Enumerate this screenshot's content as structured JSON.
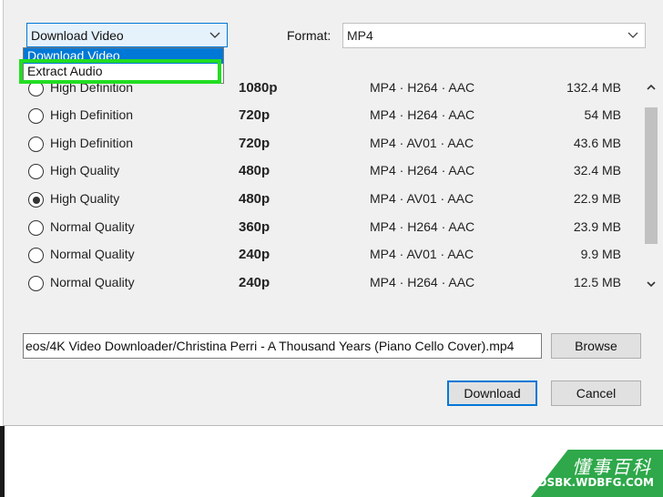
{
  "mode_select": {
    "value": "Download Video",
    "options": [
      "Download Video",
      "Extract Audio"
    ],
    "highlighted_option": "Extract Audio"
  },
  "format": {
    "label": "Format:",
    "value": "MP4"
  },
  "quality_options": [
    {
      "quality": "High Definition",
      "resolution": "1080p",
      "codec": "MP4 · H264 · AAC",
      "size": "132.4 MB",
      "selected": false
    },
    {
      "quality": "High Definition",
      "resolution": "720p",
      "codec": "MP4 · H264 · AAC",
      "size": "54 MB",
      "selected": false
    },
    {
      "quality": "High Definition",
      "resolution": "720p",
      "codec": "MP4 · AV01 · AAC",
      "size": "43.6 MB",
      "selected": false
    },
    {
      "quality": "High Quality",
      "resolution": "480p",
      "codec": "MP4 · H264 · AAC",
      "size": "32.4 MB",
      "selected": false
    },
    {
      "quality": "High Quality",
      "resolution": "480p",
      "codec": "MP4 · AV01 · AAC",
      "size": "22.9 MB",
      "selected": true
    },
    {
      "quality": "Normal Quality",
      "resolution": "360p",
      "codec": "MP4 · H264 · AAC",
      "size": "23.9 MB",
      "selected": false
    },
    {
      "quality": "Normal Quality",
      "resolution": "240p",
      "codec": "MP4 · AV01 · AAC",
      "size": "9.9 MB",
      "selected": false
    },
    {
      "quality": "Normal Quality",
      "resolution": "240p",
      "codec": "MP4 · H264 · AAC",
      "size": "12.5 MB",
      "selected": false
    }
  ],
  "save_path": {
    "value": "eos/4K Video Downloader/Christina Perri - A Thousand Years (Piano Cello Cover).mp4"
  },
  "buttons": {
    "browse": "Browse",
    "download": "Download",
    "cancel": "Cancel"
  },
  "watermark": {
    "chinese": "懂事百科",
    "url": "DSBK.WDBFG.COM"
  },
  "colors": {
    "accent": "#0078d7",
    "highlight": "#22dd22",
    "watermark_green": "#2ea84a"
  }
}
